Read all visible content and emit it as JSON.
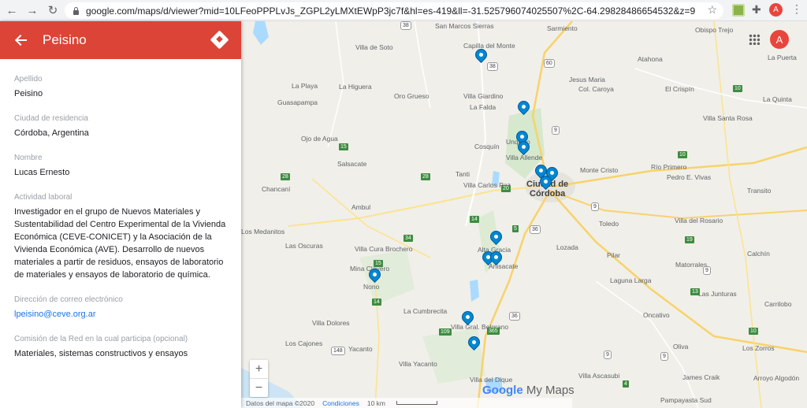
{
  "browser": {
    "url": "google.com/maps/d/viewer?mid=10LFeoPPPLvJs_ZGPL2yLMXtEWpP3jc7f&hl=es-419&ll=-31.525796074025507%2C-64.29828486654532&z=9",
    "avatar_letter": "A"
  },
  "panel": {
    "title": "Peisino",
    "fields": [
      {
        "label": "Apellido",
        "value": "Peisino"
      },
      {
        "label": "Ciudad de residencia",
        "value": "Córdoba, Argentina"
      },
      {
        "label": "Nombre",
        "value": "Lucas Ernesto"
      },
      {
        "label": "Actividad laboral",
        "value": "Investigador en el grupo de Nuevos Materiales y Sustentabilidad del Centro Experimental de la Vivienda Económica (CEVE-CONICET) y la Asociación de la Vivienda Económica (AVE). Desarrollo de nuevos materiales a partir de residuos, ensayos de laboratorio de materiales y ensayos de laboratorio de química."
      },
      {
        "label": "Dirección de correo electrónico",
        "value": "lpeisino@ceve.org.ar"
      },
      {
        "label": "Comisión de la Red en la cual participa (opcional)",
        "value": "Materiales, sistemas constructivos y ensayos"
      }
    ]
  },
  "map": {
    "avatar_letter": "A",
    "zoom_in": "+",
    "zoom_out": "−",
    "logo_google": "Google",
    "logo_mymaps": "My Maps",
    "attribution": "Datos del mapa ©2020",
    "terms": "Condiciones",
    "scale_label": "10 km",
    "city": "Córdoba",
    "city_prefix": "Ciudad de",
    "places": [
      "San Marcos Sierras",
      "Sarmiento",
      "Obispo Trejo",
      "Villa de Soto",
      "Capilla del Monte",
      "La Puerta",
      "Atahona",
      "Jesus Maria",
      "Col. Caroya",
      "El Crispín",
      "La Playa",
      "La Higuera",
      "Oro Grueso",
      "Villa Giardino",
      "La Falda",
      "Guasapampa",
      "La Quinta",
      "Villa Santa Rosa",
      "Unquillo",
      "Cosquín",
      "Ojo de Agua",
      "Villa Allende",
      "Salsacate",
      "Tanti",
      "Monte Cristo",
      "Río Primero",
      "Pedro E. Vivas",
      "Chancaní",
      "Villa Carlos Paz",
      "Transito",
      "Ambul",
      "Villa del Rosario",
      "Alta Gracia",
      "Toledo",
      "Los Medanitos",
      "Las Oscuras",
      "Villa Cura Brochero",
      "Lozada",
      "Pilar",
      "Calchín",
      "Mina Clavero",
      "Anisacate",
      "Matorrales",
      "Laguna Larga",
      "Nono",
      "Las Junturas",
      "Carrilobo",
      "La Cumbrecita",
      "Villa Dolores",
      "Villa Gral. Belgrano",
      "Oncativo",
      "Los Cajones",
      "Yacanto",
      "Oliva",
      "Los Zorros",
      "Villa Yacanto",
      "Villa Ascasubi",
      "James Craik",
      "Villa del Dique",
      "Arroyo Algodón",
      "Pampayasta Sud"
    ],
    "road_labels": [
      "38",
      "38",
      "60",
      "9",
      "15",
      "28",
      "28",
      "20",
      "14",
      "34",
      "5",
      "36",
      "9",
      "9",
      "10",
      "10",
      "19",
      "13",
      "10",
      "9",
      "14",
      "109",
      "365",
      "36",
      "148",
      "4",
      "15",
      "9"
    ]
  }
}
